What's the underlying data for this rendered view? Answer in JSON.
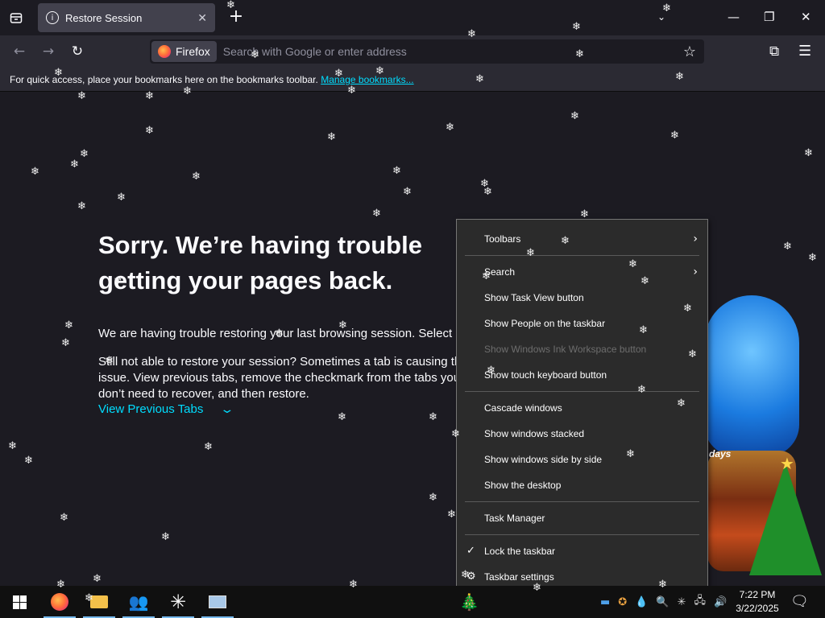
{
  "browser": {
    "tab_title": "Restore Session",
    "identity_label": "Firefox",
    "url_placeholder": "Search with Google or enter address",
    "bookmarks_text": "For quick access, place your bookmarks here on the bookmarks toolbar.",
    "bookmarks_link": "Manage bookmarks..."
  },
  "page": {
    "title": "Sorry. We’re having trouble getting your pages back.",
    "description": "We are having trouble restoring your last browsing session. Select Restore Session to try again.",
    "description2": "Still not able to restore your session? Sometimes a tab is causing the issue. View previous tabs, remove the checkmark from the tabs you don’t need to recover, and then restore.",
    "view_previous": "View Previous Tabs"
  },
  "context_menu": {
    "toolbars": "Toolbars",
    "search": "Search",
    "show_task_view": "Show Task View button",
    "show_people": "Show People on the taskbar",
    "show_ink": "Show Windows Ink Workspace button",
    "show_touch_keyboard": "Show touch keyboard button",
    "cascade": "Cascade windows",
    "stacked": "Show windows stacked",
    "side_by_side": "Show windows side by side",
    "show_desktop": "Show the desktop",
    "task_manager": "Task Manager",
    "lock_taskbar": "Lock the taskbar",
    "taskbar_settings": "Taskbar settings"
  },
  "decor": {
    "globe_label": "days"
  },
  "taskbar": {
    "time": "7:22 PM",
    "date": "3/22/2025"
  },
  "icons": {
    "overview": "tab-overview-icon",
    "info": "info-icon",
    "close": "close-icon",
    "back": "back-icon",
    "forward": "forward-icon",
    "reload": "reload-icon",
    "star": "bookmark-star-icon",
    "extensions": "extensions-icon",
    "menu": "hamburger-menu-icon"
  },
  "colors": {
    "accent_link": "#00ddff",
    "menu_bg": "#2b2b2b",
    "taskbar_bg": "#101010"
  }
}
